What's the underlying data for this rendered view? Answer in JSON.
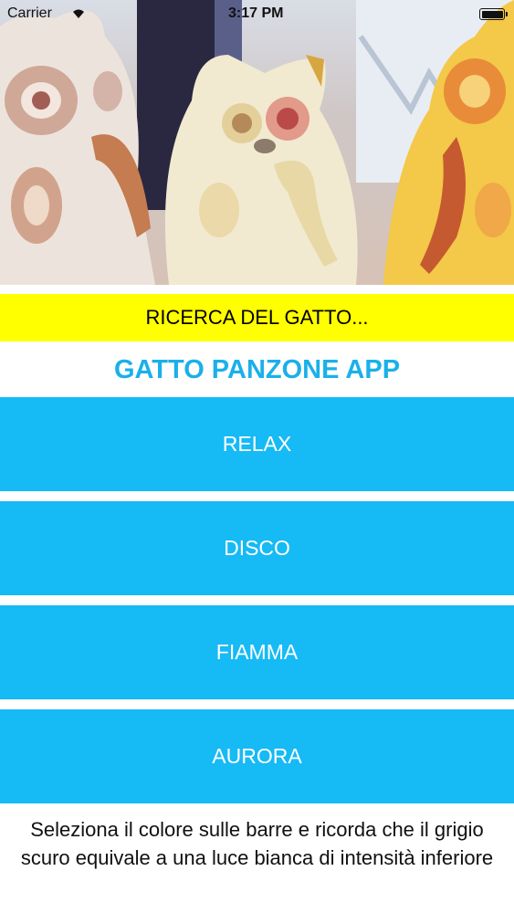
{
  "status_bar": {
    "carrier": "Carrier",
    "time": "3:17 PM",
    "wifi_icon": "wifi-icon",
    "battery_icon": "battery-icon"
  },
  "hero": {
    "image": "painted-cat-figurines"
  },
  "search_banner": {
    "text": "RICERCA DEL GATTO...",
    "color": "#ffff00"
  },
  "app_title": {
    "text": "GATTO PANZONE APP",
    "color": "#1ab0ea"
  },
  "modes": {
    "relax": "RELAX",
    "disco": "DISCO",
    "fiamma": "FIAMMA",
    "aurora": "AURORA",
    "button_color": "#16baf5"
  },
  "instructions": {
    "text": "Seleziona il colore sulle barre e ricorda che il grigio scuro equivale a una luce bianca di intensità inferiore"
  }
}
